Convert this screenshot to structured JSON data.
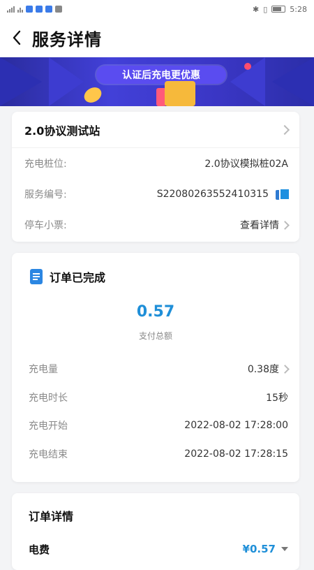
{
  "status_bar": {
    "time": "5:28"
  },
  "header": {
    "title": "服务详情"
  },
  "banner": {
    "promo_text": "认证后充电更优惠"
  },
  "station_card": {
    "station_name": "2.0协议测试站",
    "pile_label": "充电桩位:",
    "pile_value": "2.0协议模拟桩02A",
    "service_no_label": "服务编号:",
    "service_no_value": "S22080263552410315",
    "parking_label": "停车小票:",
    "parking_link": "查看详情"
  },
  "order_card": {
    "status": "订单已完成",
    "amount": "0.57",
    "amount_label": "支付总额",
    "rows": [
      {
        "label": "充电量",
        "value": "0.38度"
      },
      {
        "label": "充电时长",
        "value": "15秒"
      },
      {
        "label": "充电开始",
        "value": "2022-08-02 17:28:00"
      },
      {
        "label": "充电结束",
        "value": "2022-08-02 17:28:15"
      }
    ]
  },
  "order_detail": {
    "title": "订单详情",
    "fee_label": "电费",
    "fee_value": "¥0.57"
  },
  "colors": {
    "accent": "#1f8fd8",
    "banner": "#3a36c4",
    "background": "#f3f4f6"
  }
}
